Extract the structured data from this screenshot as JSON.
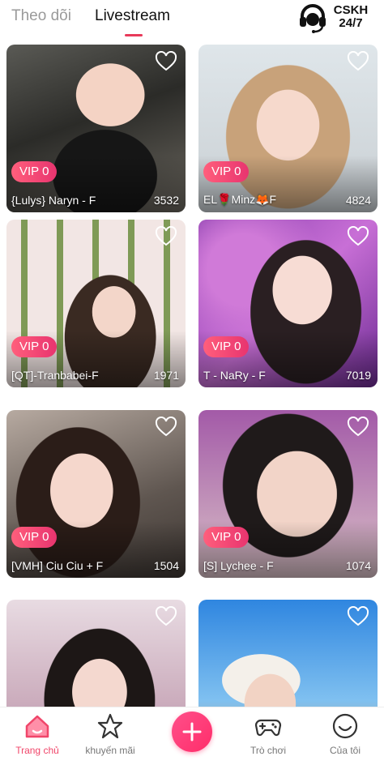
{
  "header": {
    "tabs": [
      {
        "label": "Theo dõi",
        "active": false
      },
      {
        "label": "Livestream",
        "active": true
      }
    ],
    "support": {
      "line1": "CSKH",
      "line2": "24/7",
      "icon": "headset-icon"
    }
  },
  "streams": [
    {
      "vip": "VIP 0",
      "name": "{Lulys} Naryn - F",
      "viewers": "3532"
    },
    {
      "vip": "VIP 0",
      "name": "EL🌹Minz🦊F",
      "viewers": "4824"
    },
    {
      "vip": "VIP 0",
      "name": "[QT]-Tranbabei-F",
      "viewers": "1971"
    },
    {
      "vip": "VIP 0",
      "name": "T - NaRy - F",
      "viewers": "7019"
    },
    {
      "vip": "VIP 0",
      "name": "[VMH] Ciu Ciu + F",
      "viewers": "1504"
    },
    {
      "vip": "VIP 0",
      "name": "[S] Lychee - F",
      "viewers": "1074"
    },
    {
      "vip": "",
      "name": "",
      "viewers": ""
    },
    {
      "vip": "",
      "name": "",
      "viewers": ""
    }
  ],
  "nav": {
    "items": [
      {
        "label": "Trang chủ",
        "icon": "home-icon",
        "active": true
      },
      {
        "label": "khuyến mãi",
        "icon": "star-icon",
        "active": false
      },
      {
        "label": "",
        "icon": "plus-icon",
        "active": false
      },
      {
        "label": "Trò chơi",
        "icon": "gamepad-icon",
        "active": false
      },
      {
        "label": "Của tôi",
        "icon": "smile-icon",
        "active": false
      }
    ]
  },
  "colors": {
    "accent": "#f0466a",
    "vip_badge": "#f0466a",
    "inactive_text": "#9a9a9a"
  }
}
